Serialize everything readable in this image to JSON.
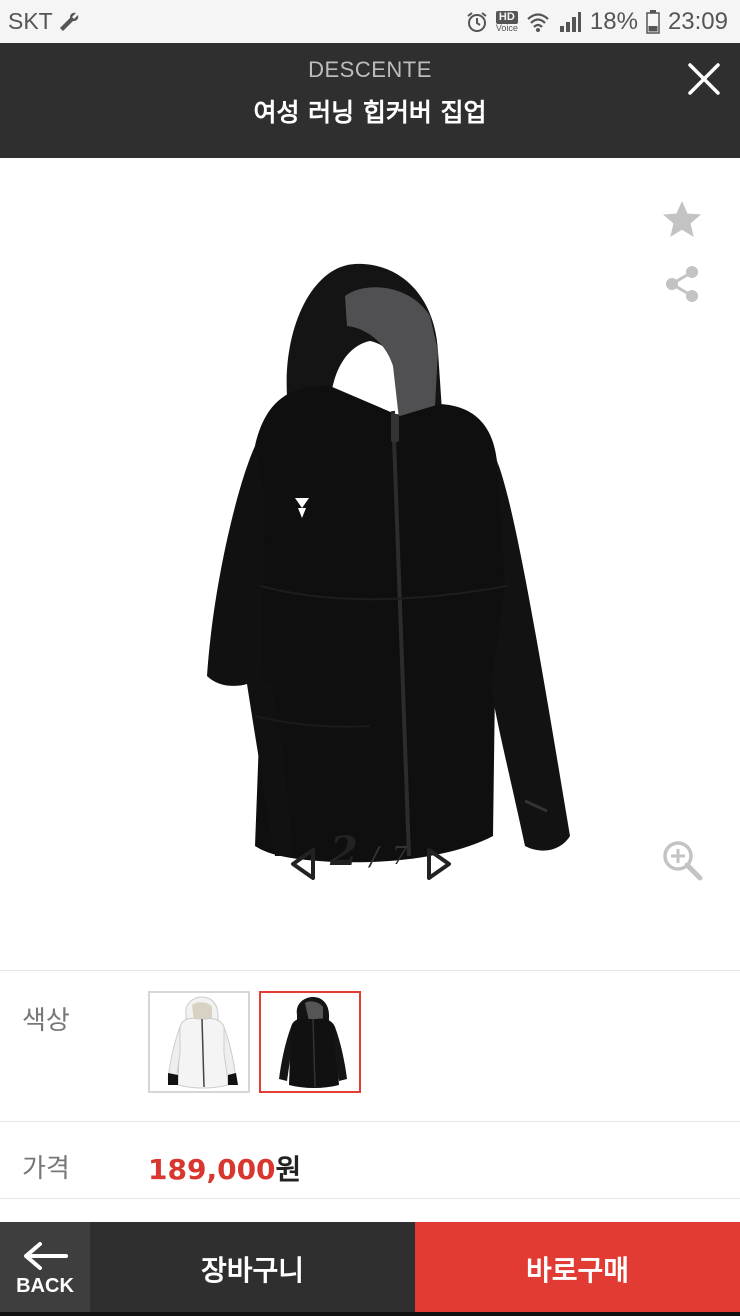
{
  "status_bar": {
    "carrier": "SKT",
    "hd_label": "HD",
    "voice_label": "Voice",
    "battery": "18%",
    "time": "23:09",
    "icons": [
      "wrench-icon",
      "alarm-icon",
      "wifi-icon",
      "signal-icon",
      "battery-icon"
    ]
  },
  "header": {
    "brand": "DESCENTE",
    "title": "여성 러닝 힙커버 집업",
    "close_icon": "close-icon"
  },
  "gallery": {
    "current_page": "2",
    "separator": "/",
    "total_pages": "7",
    "icons": [
      "star-icon",
      "share-icon",
      "prev-arrow-icon",
      "next-arrow-icon",
      "zoom-in-icon"
    ]
  },
  "color_option": {
    "label": "색상",
    "swatches": [
      "white",
      "black"
    ],
    "selected": "black"
  },
  "price": {
    "label": "가격",
    "value": "189,000",
    "unit": "원"
  },
  "bottom_bar": {
    "back_label": "BACK",
    "cart_label": "장바구니",
    "buy_label": "바로구매"
  },
  "colors": {
    "header_bg": "#2f2f2f",
    "accent_red": "#e13b33",
    "price_red": "#d8372f"
  }
}
